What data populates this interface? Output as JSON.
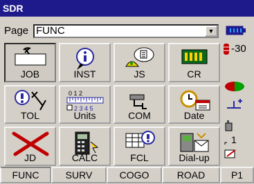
{
  "window": {
    "title": "SDR"
  },
  "page_selector": {
    "label": "Page",
    "value": "FUNC"
  },
  "tiles": [
    {
      "label": "JOB"
    },
    {
      "label": "INST"
    },
    {
      "label": "JS"
    },
    {
      "label": "CR"
    },
    {
      "label": "TOL"
    },
    {
      "label": "Units"
    },
    {
      "label": "COM"
    },
    {
      "label": "Date"
    },
    {
      "label": "JD"
    },
    {
      "label": "CALC"
    },
    {
      "label": "FCL"
    },
    {
      "label": "Dial-up"
    }
  ],
  "units_scale": {
    "top": "0  1  2",
    "bottom": "2 3 4 5"
  },
  "status": {
    "signal_text": "-30",
    "count_text": "1"
  },
  "tabs": [
    {
      "label": "FUNC",
      "active": true
    },
    {
      "label": "SURV"
    },
    {
      "label": "COGO"
    },
    {
      "label": "ROAD"
    },
    {
      "label": "P1"
    }
  ],
  "colors": {
    "titlebar": "#1f1a8c",
    "accent_blue": "#2a2aa0",
    "red": "#c00000",
    "green": "#00a000"
  }
}
